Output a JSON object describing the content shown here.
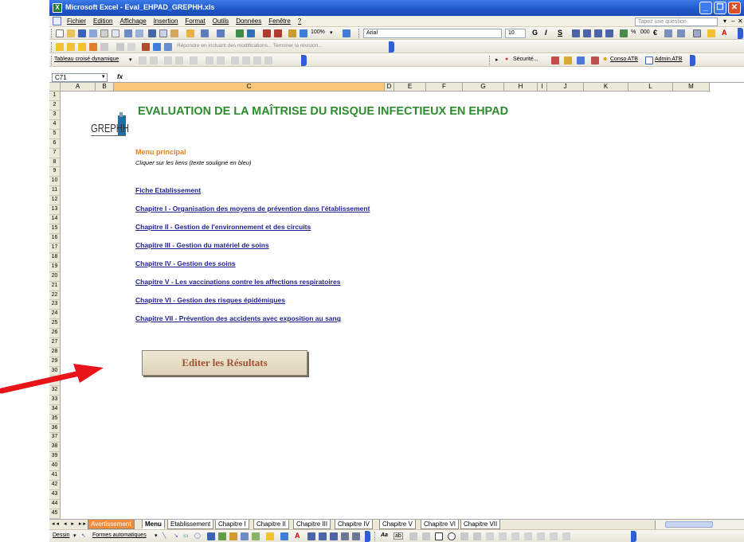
{
  "window": {
    "title": "Microsoft Excel - Eval_EHPAD_GREPHH.xls",
    "app_icon": "X"
  },
  "menubar": {
    "items": [
      "Fichier",
      "Edition",
      "Affichage",
      "Insertion",
      "Format",
      "Outils",
      "Données",
      "Fenêtre",
      "?"
    ],
    "question_placeholder": "Tapez une question"
  },
  "toolbar": {
    "zoom": "100%",
    "font": "Arial",
    "font_size": "10",
    "bold": "G",
    "italic": "I",
    "underline": "S",
    "percent": "%",
    "thousands": "000",
    "review_text": "Répondre en incluant des modifications...  Terminer la révision...",
    "pivot_label": "Tableau croisé dynamique",
    "security_label": "Sécurité...",
    "conso_label": "Conso ATB",
    "admin_label": "Admin ATB"
  },
  "formula": {
    "namebox": "C71",
    "fx": "fx",
    "value": ""
  },
  "columns": [
    "A",
    "B",
    "C",
    "D",
    "E",
    "F",
    "G",
    "H",
    "I",
    "J",
    "K",
    "L",
    "M"
  ],
  "active_column": "C",
  "rows": [
    "1",
    "2",
    "3",
    "4",
    "5",
    "6",
    "7",
    "8",
    "9",
    "10",
    "11",
    "12",
    "13",
    "14",
    "15",
    "16",
    "17",
    "18",
    "19",
    "20",
    "21",
    "22",
    "23",
    "24",
    "25",
    "26",
    "27",
    "28",
    "29",
    "30",
    "31",
    "32",
    "33",
    "34",
    "35",
    "36",
    "37",
    "38",
    "39",
    "40",
    "41",
    "42",
    "43",
    "44",
    "45"
  ],
  "sheet": {
    "logo_text": "GREPHH",
    "title": "EVALUATION DE LA MAÎTRISE DU RISQUE INFECTIEUX EN EHPAD",
    "menu_label": "Menu principal",
    "instruction": "Cliquer sur les liens (texte souligné en bleu)",
    "links": [
      "Fiche Etablissement",
      "Chapitre I - Organisation des moyens de prévention dans l'établissement",
      "Chapitre II - Gestion de l'environnement et des circuits",
      "Chapitre III - Gestion du matériel de soins",
      "Chapitre IV - Gestion des soins",
      "Chapitre V - Les vaccinations contre les affections respiratoires",
      "Chapitre VI - Gestion des risques épidémiques",
      "Chapitre VII - Prévention des accidents avec exposition au sang"
    ],
    "results_button": "Editer les Résultats"
  },
  "tabs": {
    "nav": "◂◂ ◂ ▸ ▸▸",
    "items": [
      "Avertissement",
      "Menu",
      "Etablissement",
      "Chapitre I",
      "Chapitre II",
      "Chapitre III",
      "Chapitre IV",
      "Chapitre V",
      "Chapitre VI",
      "Chapitre VII"
    ],
    "active": "Menu",
    "highlighted": "Avertissement"
  },
  "drawbar": {
    "dessin": "Dessin",
    "formes": "Formes automatiques"
  },
  "colors": {
    "title_green": "#2e8b2e",
    "menu_orange": "#e0831f",
    "link_blue": "#1f1f8c",
    "button_text": "#a0522d",
    "arrow_red": "#e8141a",
    "titlebar_blue": "#1f56c8"
  }
}
